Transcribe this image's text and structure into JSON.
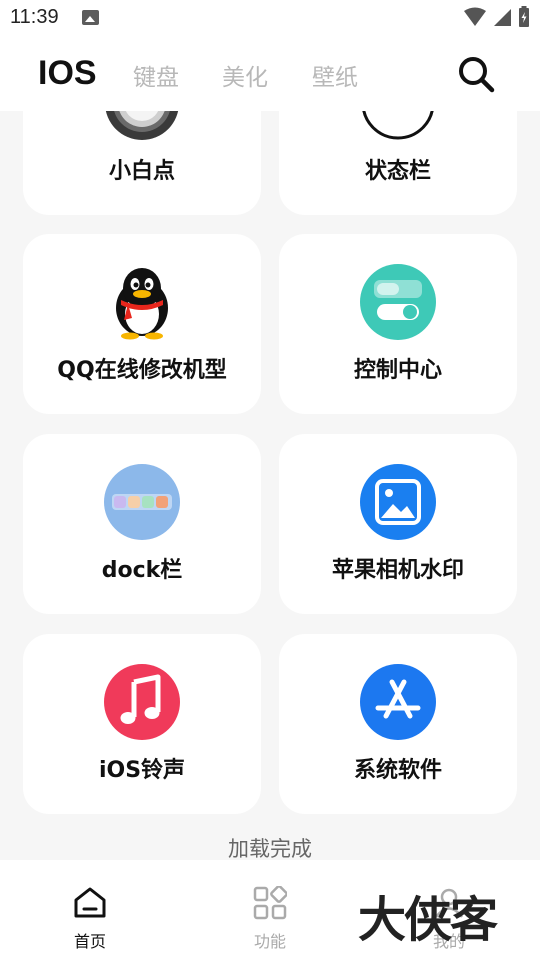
{
  "status": {
    "time": "11:39"
  },
  "header": {
    "brand": "IOS",
    "tabs": [
      "键盘",
      "美化",
      "壁纸"
    ]
  },
  "cards": [
    {
      "label": "小白点",
      "icon": "white-dot-icon"
    },
    {
      "label": "状态栏",
      "icon": "status-bar-icon"
    },
    {
      "label": "QQ在线修改机型",
      "icon": "qq-penguin-icon"
    },
    {
      "label": "控制中心",
      "icon": "control-center-icon"
    },
    {
      "label": "dock栏",
      "icon": "dock-icon"
    },
    {
      "label": "苹果相机水印",
      "icon": "photo-icon"
    },
    {
      "label": "iOS铃声",
      "icon": "music-note-icon"
    },
    {
      "label": "系统软件",
      "icon": "app-store-icon"
    }
  ],
  "footer_text": "加载完成",
  "bottom_nav": [
    {
      "label": "首页",
      "icon": "home-icon",
      "active": true
    },
    {
      "label": "功能",
      "icon": "grid-icon",
      "active": false
    },
    {
      "label": "我的",
      "icon": "profile-icon",
      "active": false
    }
  ],
  "watermark": "大侠客",
  "colors": {
    "accent_teal": "#3ec9b7",
    "photo_blue": "#1a7ff0",
    "music_red": "#f03a5a",
    "appstore_blue": "#1c78f0",
    "dock_lightblue": "#8cb8ea",
    "tab_inactive": "#b8b8b8"
  }
}
